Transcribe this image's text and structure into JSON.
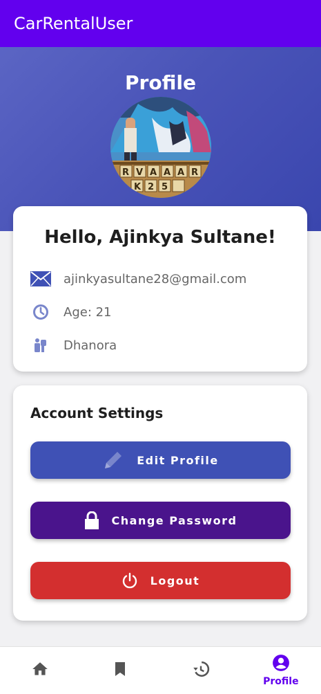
{
  "app": {
    "title": "CarRentalUser"
  },
  "header": {
    "title": "Profile"
  },
  "profile": {
    "greeting": "Hello, Ajinkya Sultane!",
    "email": "ajinkyasultane28@gmail.com",
    "age": "Age: 21",
    "location": "Dhanora"
  },
  "settings": {
    "title": "Account Settings",
    "edit_label": "Edit Profile",
    "password_label": "Change Password",
    "logout_label": "Logout"
  },
  "colors": {
    "appbar": "#6200ee",
    "edit_button": "#3f51b5",
    "password_button": "#4a148c",
    "logout_button": "#d32f2f",
    "nav_active": "#6200ee",
    "nav_inactive": "#555555",
    "info_icon": "#7986cb"
  },
  "nav": {
    "items": [
      {
        "icon": "home-icon"
      },
      {
        "icon": "bookmark-icon"
      },
      {
        "icon": "history-icon"
      },
      {
        "icon": "account-circle-icon",
        "label": "Profile",
        "active": true
      }
    ]
  }
}
